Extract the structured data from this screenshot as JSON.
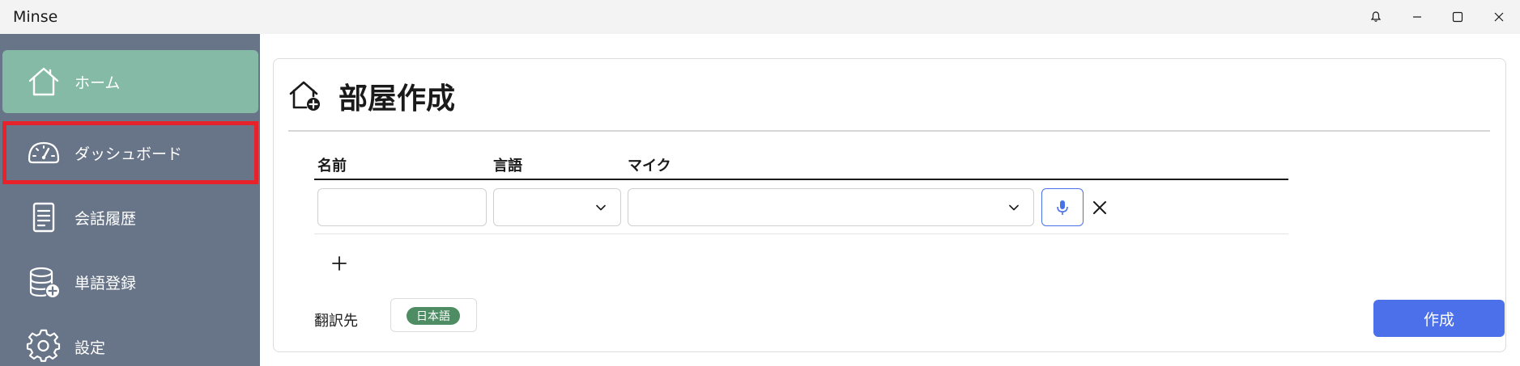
{
  "window": {
    "title": "Minse",
    "icons": [
      "bell-icon",
      "minimize-icon",
      "maximize-icon",
      "close-icon"
    ]
  },
  "sidebar": {
    "items": [
      {
        "label": "ホーム",
        "icon": "home-icon"
      },
      {
        "label": "ダッシュボード",
        "icon": "dashboard-icon"
      },
      {
        "label": "会話履歴",
        "icon": "document-icon"
      },
      {
        "label": "単語登録",
        "icon": "database-add-icon"
      },
      {
        "label": "設定",
        "icon": "gear-icon"
      }
    ],
    "active_item": "ホーム",
    "highlighted_item": "ダッシュボード"
  },
  "room": {
    "title": "部屋作成",
    "title_icon": "home-add-icon",
    "columns": {
      "name": "名前",
      "language": "言語",
      "mic": "マイク"
    },
    "row": {
      "name_value": "",
      "language_value": "",
      "mic_value": ""
    },
    "target_label": "翻訳先",
    "target_badge": "日本語",
    "create_label": "作成"
  },
  "colors": {
    "sidebar_bg": "#687487",
    "active_item_bg": "#85bba6",
    "highlight_border": "#e8222b",
    "accent": "#4c70ea",
    "badge_bg": "#4e8c63"
  }
}
